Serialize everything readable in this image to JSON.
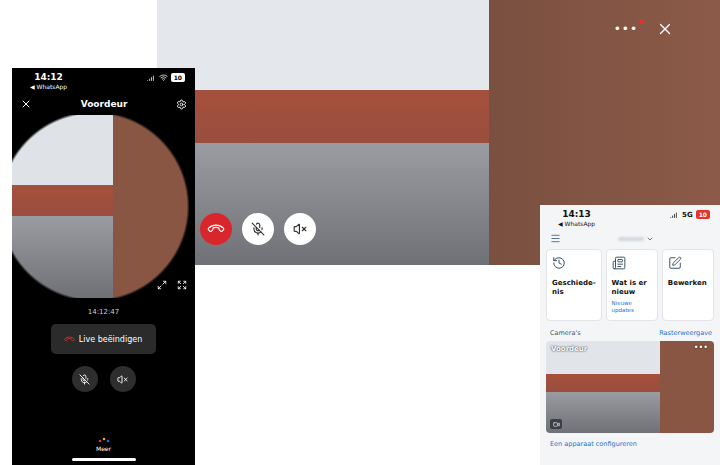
{
  "video_view": {
    "menu_glyph": "•••",
    "notification": true
  },
  "left_phone": {
    "status": {
      "time": "14:12",
      "back": "◀ WhatsApp",
      "battery": "10",
      "battery_low": false
    },
    "title": "Voordeur",
    "timestamp": "14:12:47",
    "end_button": "Live beëindigen",
    "more": "Meer"
  },
  "right_phone": {
    "status": {
      "time": "14:13",
      "back": "◀ WhatsApp",
      "network": "5G",
      "battery": "10",
      "battery_low": true
    },
    "tiles": [
      {
        "kind": "history",
        "lines": [
          "Geschiede-",
          "nis"
        ]
      },
      {
        "kind": "news",
        "lines": [
          "Wat is er",
          "nieuw"
        ],
        "sub": "Nieuwe updates"
      },
      {
        "kind": "edit",
        "lines": [
          "Bewerken"
        ]
      }
    ],
    "section": {
      "title": "Camera's",
      "action": "Rasterweergave"
    },
    "cameras": [
      {
        "name": "Voordeur",
        "menu_glyph": "•••"
      }
    ],
    "link": "Een apparaat configureren"
  }
}
